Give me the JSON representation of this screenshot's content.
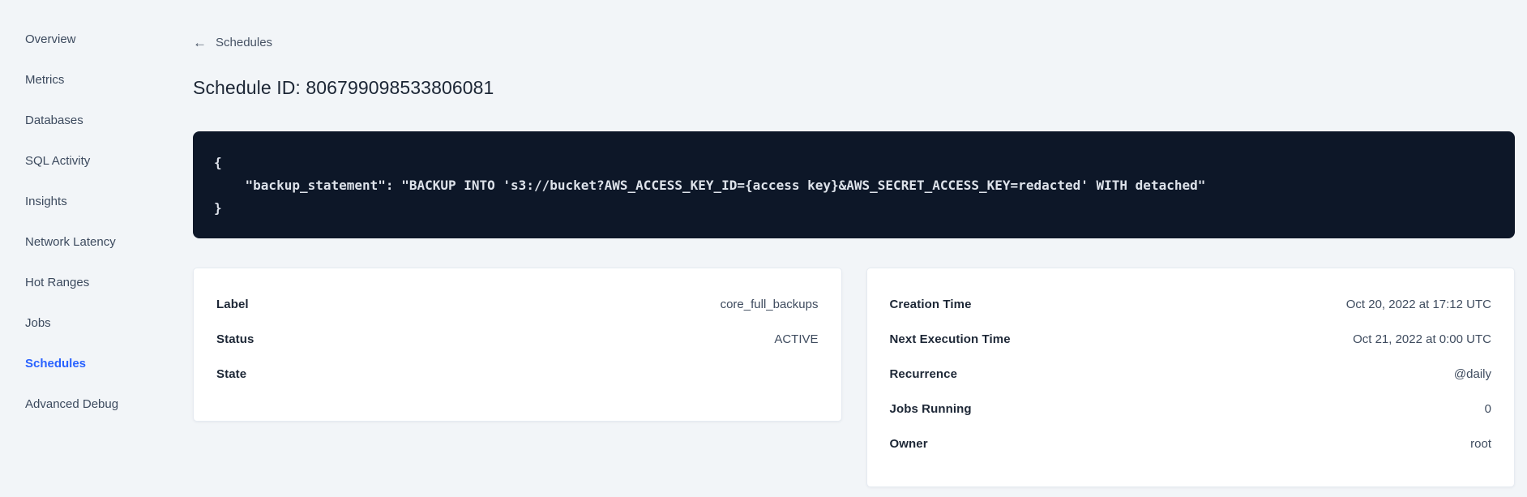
{
  "sidebar": {
    "items": [
      {
        "label": "Overview",
        "active": false
      },
      {
        "label": "Metrics",
        "active": false
      },
      {
        "label": "Databases",
        "active": false
      },
      {
        "label": "SQL Activity",
        "active": false
      },
      {
        "label": "Insights",
        "active": false
      },
      {
        "label": "Network Latency",
        "active": false
      },
      {
        "label": "Hot Ranges",
        "active": false
      },
      {
        "label": "Jobs",
        "active": false
      },
      {
        "label": "Schedules",
        "active": true
      },
      {
        "label": "Advanced Debug",
        "active": false
      }
    ]
  },
  "header": {
    "back_icon": "←",
    "back_label": "Schedules",
    "title": "Schedule ID: 806799098533806081"
  },
  "code_block": {
    "lines": [
      "{",
      "    \"backup_statement\": \"BACKUP INTO 's3://bucket?AWS_ACCESS_KEY_ID={access key}&AWS_SECRET_ACCESS_KEY=redacted' WITH detached\"",
      "}"
    ]
  },
  "cards": {
    "left": {
      "rows": [
        {
          "label": "Label",
          "value": "core_full_backups"
        },
        {
          "label": "Status",
          "value": "ACTIVE"
        },
        {
          "label": "State",
          "value": ""
        }
      ]
    },
    "right": {
      "rows": [
        {
          "label": "Creation Time",
          "value": "Oct 20, 2022 at 17:12 UTC"
        },
        {
          "label": "Next Execution Time",
          "value": "Oct 21, 2022 at 0:00 UTC"
        },
        {
          "label": "Recurrence",
          "value": "@daily"
        },
        {
          "label": "Jobs Running",
          "value": "0"
        },
        {
          "label": "Owner",
          "value": "root"
        }
      ]
    }
  },
  "colors": {
    "page_background": "#f2f5f8",
    "active_nav": "#2962ff",
    "code_background": "#0d1728",
    "code_text": "#dde2ea",
    "title_text": "#1c2635",
    "card_background": "#ffffff"
  }
}
